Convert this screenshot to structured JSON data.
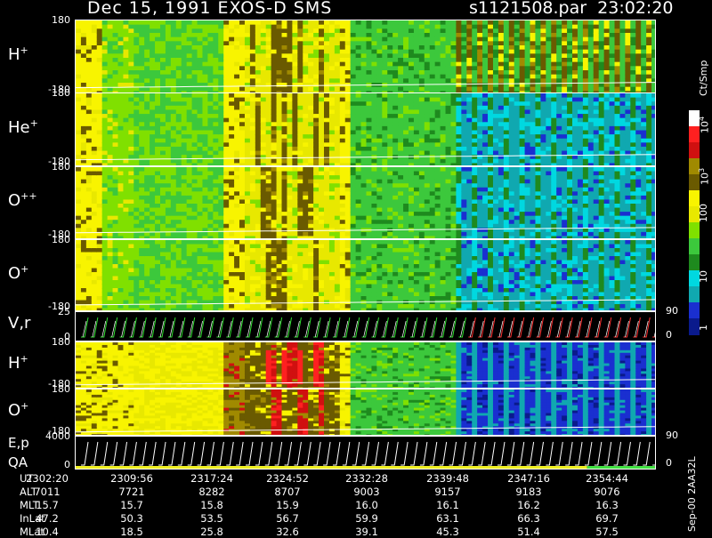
{
  "header": {
    "title": "Dec 15, 1991    EXOS-D SMS",
    "file": "s1121508.par",
    "time": "23:02:20"
  },
  "chart_data": {
    "type": "heatmap",
    "panels": [
      {
        "label_base": "H",
        "label_sup": "+",
        "ymin": "-180",
        "ymax": "180",
        "kind": "pitch"
      },
      {
        "label_base": "He",
        "label_sup": "+",
        "ymin": "-180",
        "ymax": "180",
        "kind": "pitch"
      },
      {
        "label_base": "O",
        "label_sup": "++",
        "ymin": "-180",
        "ymax": "180",
        "kind": "pitch"
      },
      {
        "label_base": "O",
        "label_sup": "+",
        "ymin": "-180",
        "ymax": "180",
        "kind": "pitch"
      },
      {
        "label_base": "V,r",
        "label_sup": "",
        "ymin": "0",
        "ymax": "25",
        "right_min": "0",
        "right_max": "90",
        "kind": "line"
      },
      {
        "label_base": "H",
        "label_sup": "+",
        "ymin": "-180",
        "ymax": "180",
        "kind": "pitch2"
      },
      {
        "label_base": "O",
        "label_sup": "+",
        "ymin": "-180",
        "ymax": "180",
        "kind": "pitch2"
      },
      {
        "label_base": "E,p",
        "label_sup": "",
        "label2": "QA",
        "ymin": "0",
        "ymax": "4000",
        "right_min": "0",
        "right_max": "90",
        "kind": "line2"
      }
    ],
    "colorbar": {
      "unit": "Ct/Smp",
      "ticks": [
        "1",
        "10",
        "100",
        "10",
        "10"
      ],
      "tick_sups": [
        "",
        "",
        "",
        "3",
        "4"
      ],
      "stops": [
        "#0a1a8c",
        "#1a2fd0",
        "#10a8b0",
        "#00d8e0",
        "#1e8a1e",
        "#3cc83c",
        "#80e000",
        "#e8e800",
        "#f8f400",
        "#6a5a00",
        "#a08a00",
        "#d01010",
        "#ff2020",
        "#ffffff"
      ]
    },
    "times": {
      "UT": [
        "2302:20",
        "2309:56",
        "2317:24",
        "2324:52",
        "2332:28",
        "2339:48",
        "2347:16",
        "2354:44"
      ],
      "ALT": [
        "7011",
        "7721",
        "8282",
        "8707",
        "9003",
        "9157",
        "9183",
        "9076"
      ],
      "MLT": [
        "15.7",
        "15.7",
        "15.8",
        "15.9",
        "16.0",
        "16.1",
        "16.2",
        "16.3"
      ],
      "InLat": [
        "47.2",
        "50.3",
        "53.5",
        "56.7",
        "59.9",
        "63.1",
        "66.3",
        "69.7"
      ],
      "MLat": [
        "10.4",
        "18.5",
        "25.8",
        "32.6",
        "39.1",
        "45.3",
        "51.4",
        "57.5"
      ]
    },
    "footer": "Sep-00  2AA32L"
  }
}
